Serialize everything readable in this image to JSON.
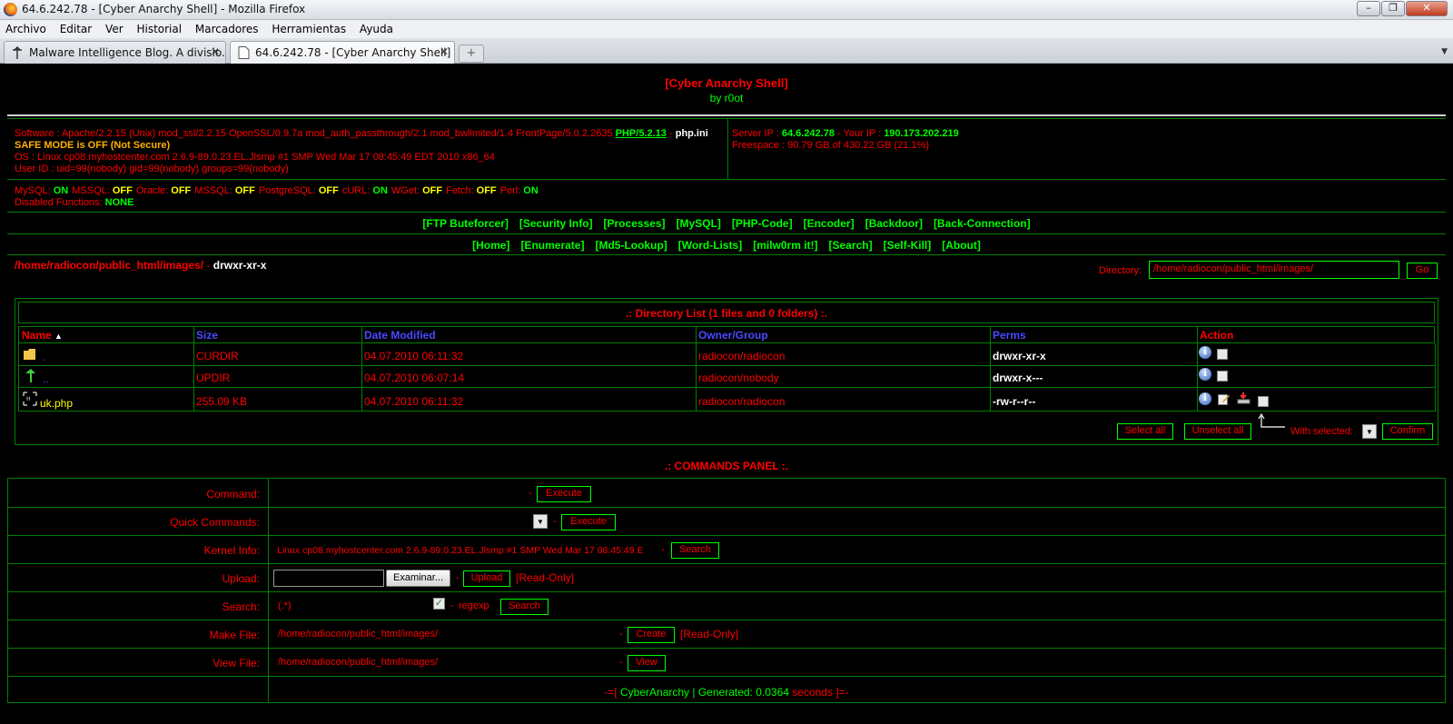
{
  "window": {
    "title": "64.6.242.78 - [Cyber Anarchy Shell] - Mozilla Firefox",
    "menu": [
      "Archivo",
      "Editar",
      "Ver",
      "Historial",
      "Marcadores",
      "Herramientas",
      "Ayuda"
    ],
    "tabs": [
      {
        "label": "Malware Intelligence Blog. A divisio...",
        "active": false
      },
      {
        "label": "64.6.242.78 - [Cyber Anarchy Shell]",
        "active": true
      }
    ],
    "newtab_label": "+"
  },
  "header": {
    "title": "[Cyber Anarchy Shell]",
    "author": "by r0ot"
  },
  "info": {
    "software_prefix": "Software : Apache/2.2.15 (Unix) mod_ssl/2.2.15 OpenSSL/0.9.7a mod_auth_passthrough/2.1 mod_bwlimited/1.4 FrontPage/5.0.2.2635",
    "php_link": "PHP/5.2.13",
    "php_sep": "-",
    "php_ini": "php.ini",
    "safe_mode": "SAFE MODE is OFF (Not Secure)",
    "os": "OS : Linux cp08.myhostcenter.com 2.6.9-89.0.23.EL.Jlsmp #1 SMP Wed Mar 17 08:45:49 EDT 2010 x86_64",
    "user_id": "User ID : uid=99(nobody) gid=99(nobody) groups=99(nobody)",
    "server_ip_label": "Server IP :",
    "server_ip": "64.6.242.78",
    "your_ip_label": "- Your IP :",
    "your_ip": "190.173.202.219",
    "freespace": "Freespace : 90.79 GB of 430.22 GB (21.1%)"
  },
  "modules": [
    {
      "name": "MySQL:",
      "state": "ON"
    },
    {
      "name": "MSSQL:",
      "state": "OFF"
    },
    {
      "name": "Oracle:",
      "state": "OFF"
    },
    {
      "name": "MSSQL:",
      "state": "OFF"
    },
    {
      "name": "PostgreSQL:",
      "state": "OFF"
    },
    {
      "name": "cURL:",
      "state": "ON"
    },
    {
      "name": "WGet:",
      "state": "OFF"
    },
    {
      "name": "Fetch:",
      "state": "OFF"
    },
    {
      "name": "Perl:",
      "state": "ON"
    }
  ],
  "disabled_functions": {
    "label": "Disabled Functions:",
    "value": "NONE"
  },
  "nav1": [
    "[FTP Buteforcer]",
    "[Security Info]",
    "[Processes]",
    "[MySQL]",
    "[PHP-Code]",
    "[Encoder]",
    "[Backdoor]",
    "[Back-Connection]"
  ],
  "nav2": [
    "[Home]",
    "[Enumerate]",
    "[Md5-Lookup]",
    "[Word-Lists]",
    "[milw0rm it!]",
    "[Search]",
    "[Self-Kill]",
    "[About]"
  ],
  "path": {
    "current": "/home/radiocon/public_html/images/",
    "sep": "-",
    "perms": "drwxr-xr-x"
  },
  "directory": {
    "label": "Directory:",
    "value": "/home/radiocon/public_html/images/",
    "go": "Go"
  },
  "dirlist": {
    "title": ".: Directory List (1 files and 0 folders) :.",
    "headers": {
      "name": "Name",
      "sort_icon": "▲",
      "size": "Size",
      "date": "Date Modified",
      "owner": "Owner/Group",
      "perms": "Perms",
      "action": "Action"
    },
    "rows": [
      {
        "icon": "folder-icon",
        "name": ".",
        "size": "CURDIR",
        "date": "04.07.2010 06:11:32",
        "owner": "radiocon/radiocon",
        "perms": "drwxr-xr-x"
      },
      {
        "icon": "up-arrow-icon",
        "name": "..",
        "size": "UPDIR",
        "date": "04.07.2010 06:07:14",
        "owner": "radiocon/nobody",
        "perms": "drwxr-x---"
      },
      {
        "icon": "php-file-icon",
        "name": "uk.php",
        "size": "255.09 KB",
        "date": "04.07.2010 06:11:32",
        "owner": "radiocon/radiocon",
        "perms": "-rw-r--r--"
      }
    ],
    "select_all": "Select all",
    "unselect_all": "Unselect all",
    "with_selected": "With selected:",
    "confirm": "Confirm"
  },
  "commands": {
    "title": ".: COMMANDS PANEL :.",
    "rows": {
      "command": {
        "label": "Command:",
        "sep": "-",
        "button": "Execute"
      },
      "quick": {
        "label": "Quick Commands:",
        "sep": "-",
        "button": "Execute"
      },
      "kernel": {
        "label": "Kernel Info:",
        "value": "Linux cp08.myhostcenter.com 2.6.9-89.0.23.EL.Jlsmp #1 SMP Wed Mar 17 08:45:49 E",
        "sep": "-",
        "button": "Search"
      },
      "upload": {
        "label": "Upload:",
        "browse": "Examinar...",
        "sep": "-",
        "button": "Upload",
        "note": "[Read-Only]"
      },
      "search": {
        "label": "Search:",
        "value": "(.*)",
        "sep": "-",
        "regexp": "regexp",
        "button": "Search"
      },
      "make_file": {
        "label": "Make File:",
        "value": "/home/radiocon/public_html/images/",
        "sep": "-",
        "button": "Create",
        "note": "[Read-Only]"
      },
      "view_file": {
        "label": "View File:",
        "value": "/home/radiocon/public_html/images/",
        "sep": "-",
        "button": "View"
      }
    }
  },
  "footer": {
    "prefix": "-=[",
    "name": "CyberAnarchy",
    "pipe": "|",
    "generated": "Generated:",
    "time": "0.0364",
    "seconds": "seconds",
    "suffix": "]=-"
  },
  "colors": {
    "background": "#000000",
    "text": "#ff0000",
    "accent": "#00ff00",
    "border": "#008000",
    "header_blue": "#4949ff"
  }
}
